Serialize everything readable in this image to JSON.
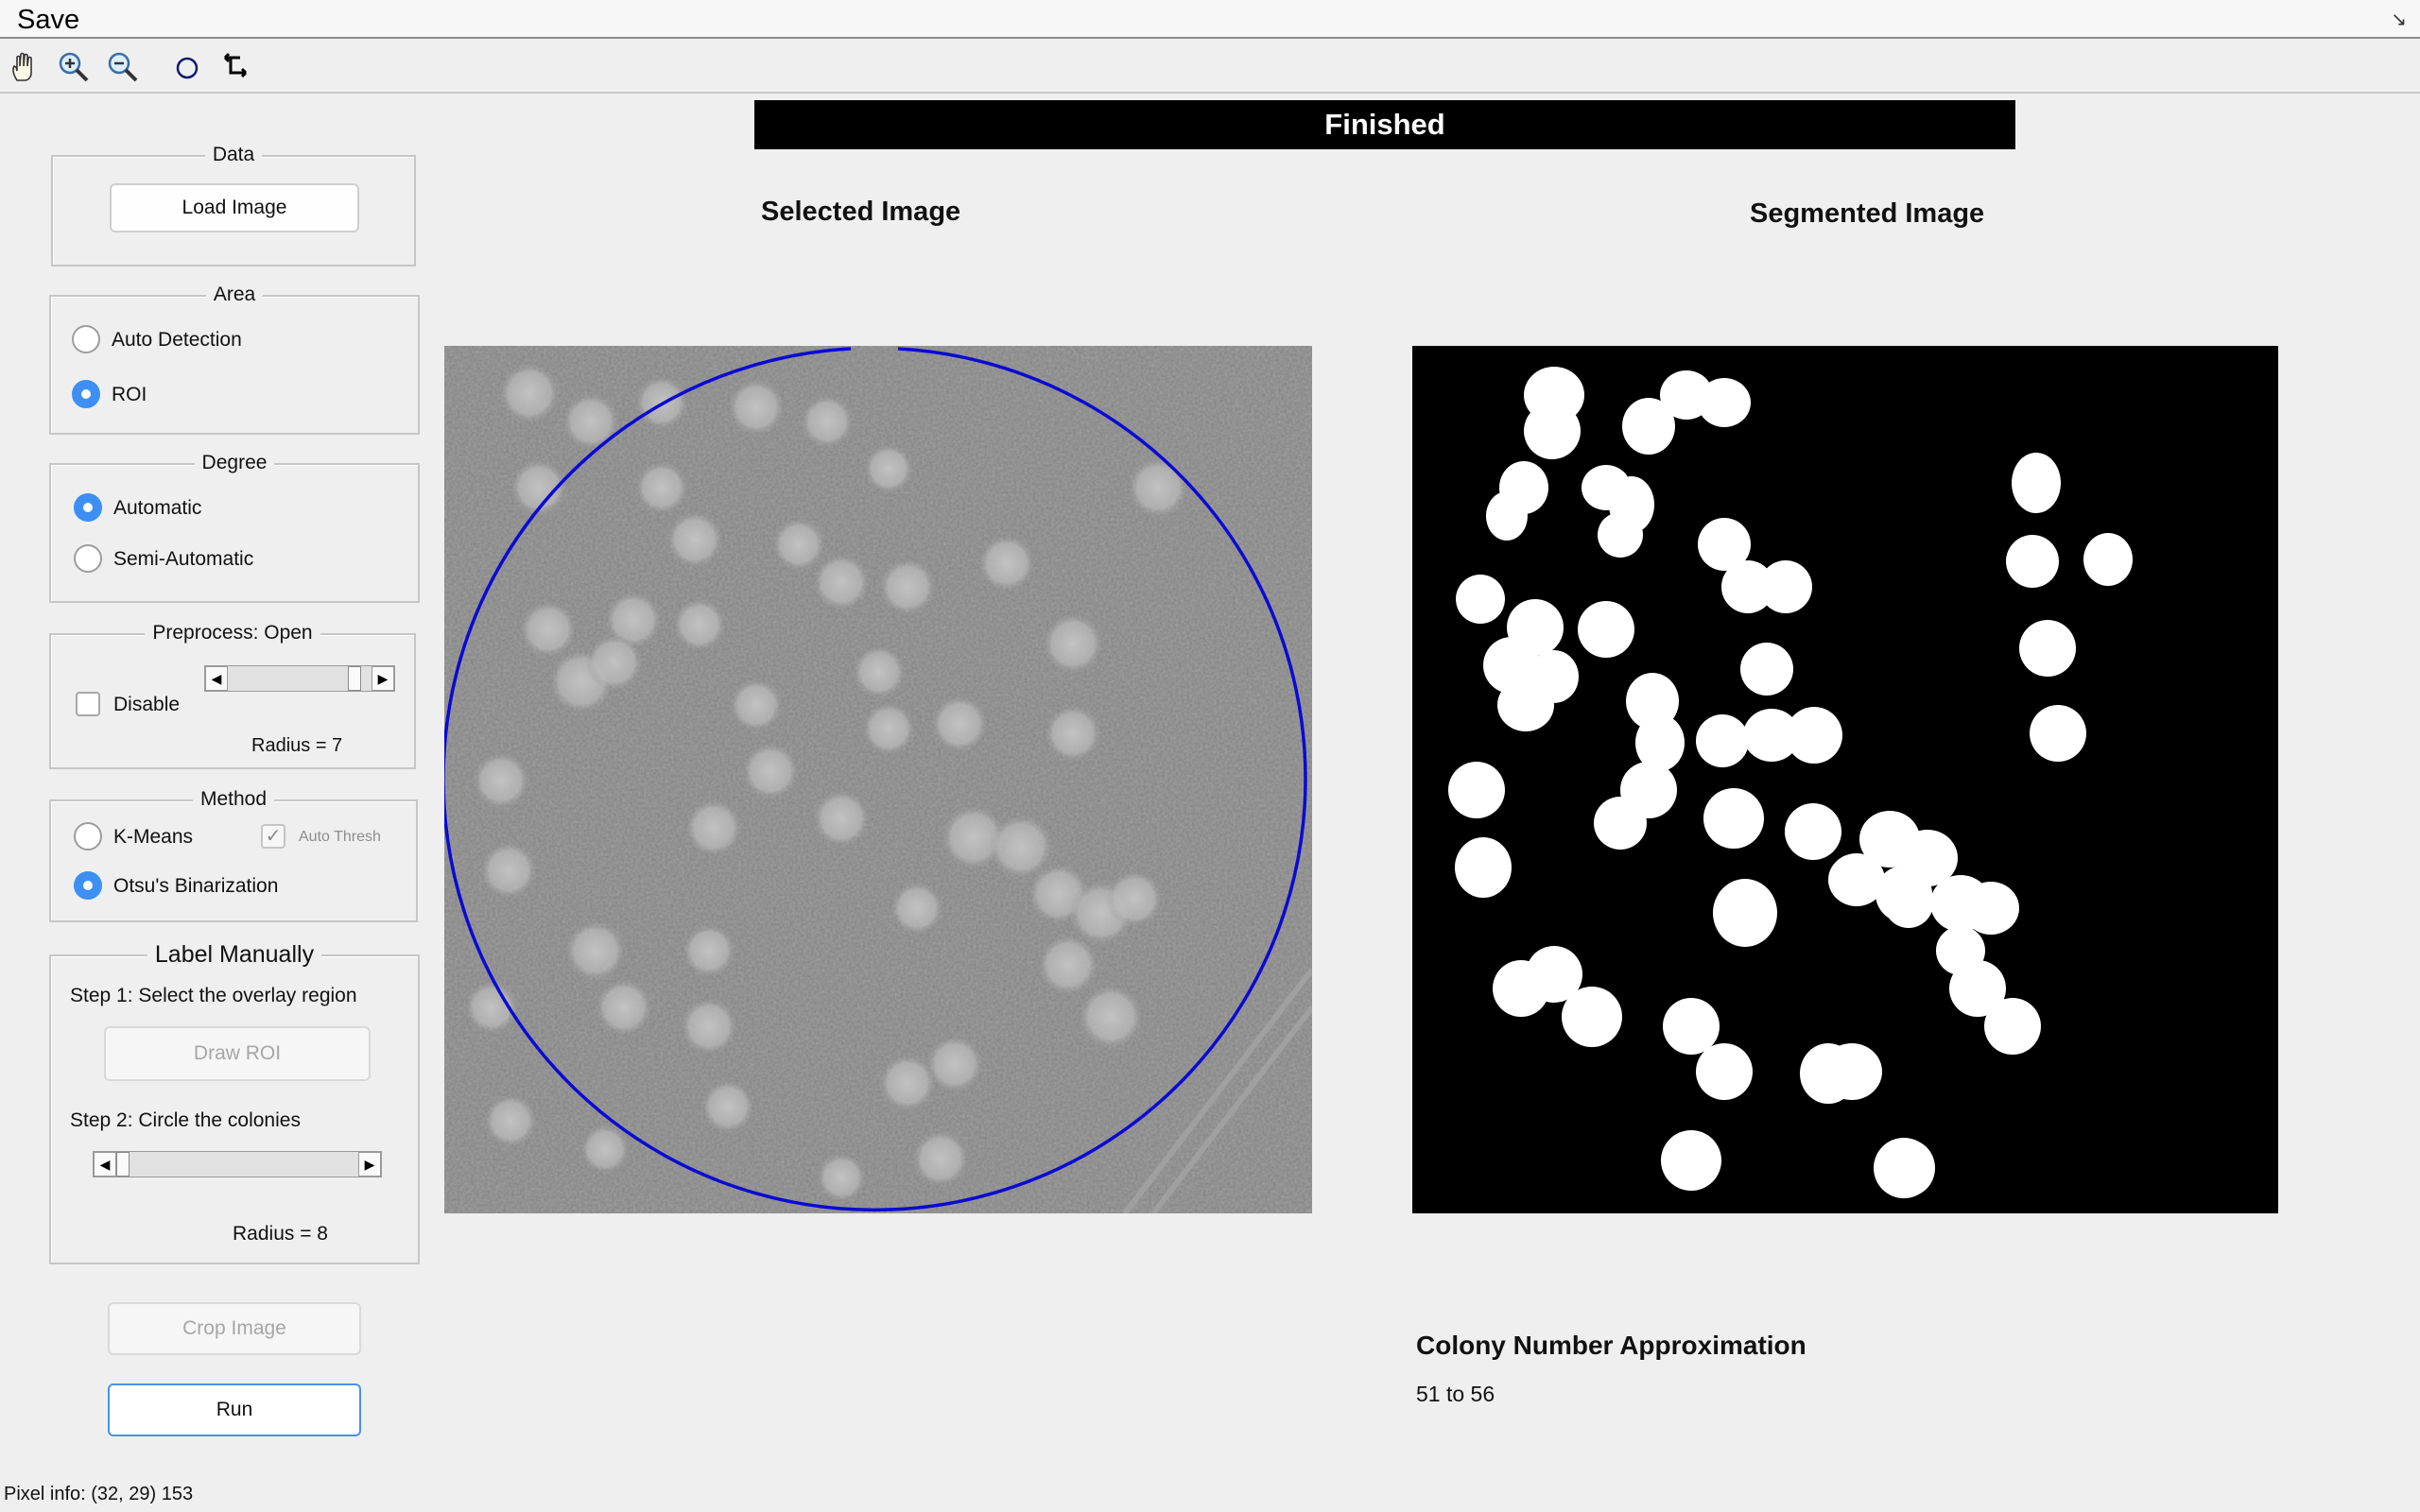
{
  "menubar": {
    "save_label": "Save"
  },
  "toolbar": {
    "tools": [
      "pan-hand-icon",
      "zoom-in-icon",
      "zoom-out-icon",
      "circle-icon",
      "swap-arrows-icon"
    ]
  },
  "status": {
    "text": "Finished",
    "background": "#000000",
    "color": "#ffffff"
  },
  "data_panel": {
    "title": "Data",
    "load_label": "Load Image"
  },
  "area_panel": {
    "title": "Area",
    "options": [
      {
        "label": "Auto Detection",
        "selected": false
      },
      {
        "label": "ROI",
        "selected": true
      }
    ]
  },
  "degree_panel": {
    "title": "Degree",
    "options": [
      {
        "label": "Automatic",
        "selected": true
      },
      {
        "label": "Semi-Automatic",
        "selected": false
      }
    ]
  },
  "preprocess_panel": {
    "title": "Preprocess: Open",
    "disable_label": "Disable",
    "disable_checked": false,
    "radius_text": "Radius = 7",
    "slider_fraction": 0.92
  },
  "method_panel": {
    "title": "Method",
    "options": [
      {
        "label": "K-Means",
        "selected": false
      },
      {
        "label": "Otsu's Binarization",
        "selected": true
      }
    ],
    "auto_thresh_label": "Auto Thresh",
    "auto_thresh_checked": true
  },
  "label_panel": {
    "title": "Label Manually",
    "step1": "Step 1: Select the overlay region",
    "draw_roi_label": "Draw ROI",
    "step2": "Step 2: Circle the colonies",
    "radius_text": "Radius = 8",
    "slider_fraction": 0.0
  },
  "actions": {
    "crop_label": "Crop Image",
    "run_label": "Run"
  },
  "pixel_info": "Pixel info: (32, 29)  153",
  "selected_image": {
    "title": "Selected Image",
    "roi_color": "#0a0ad2"
  },
  "segmented_image": {
    "title": "Segmented Image"
  },
  "result": {
    "title": "Colony Number Approximation",
    "value": "51 to 56"
  },
  "colors": {
    "accent": "#3d8ff3",
    "background": "#efefef"
  }
}
